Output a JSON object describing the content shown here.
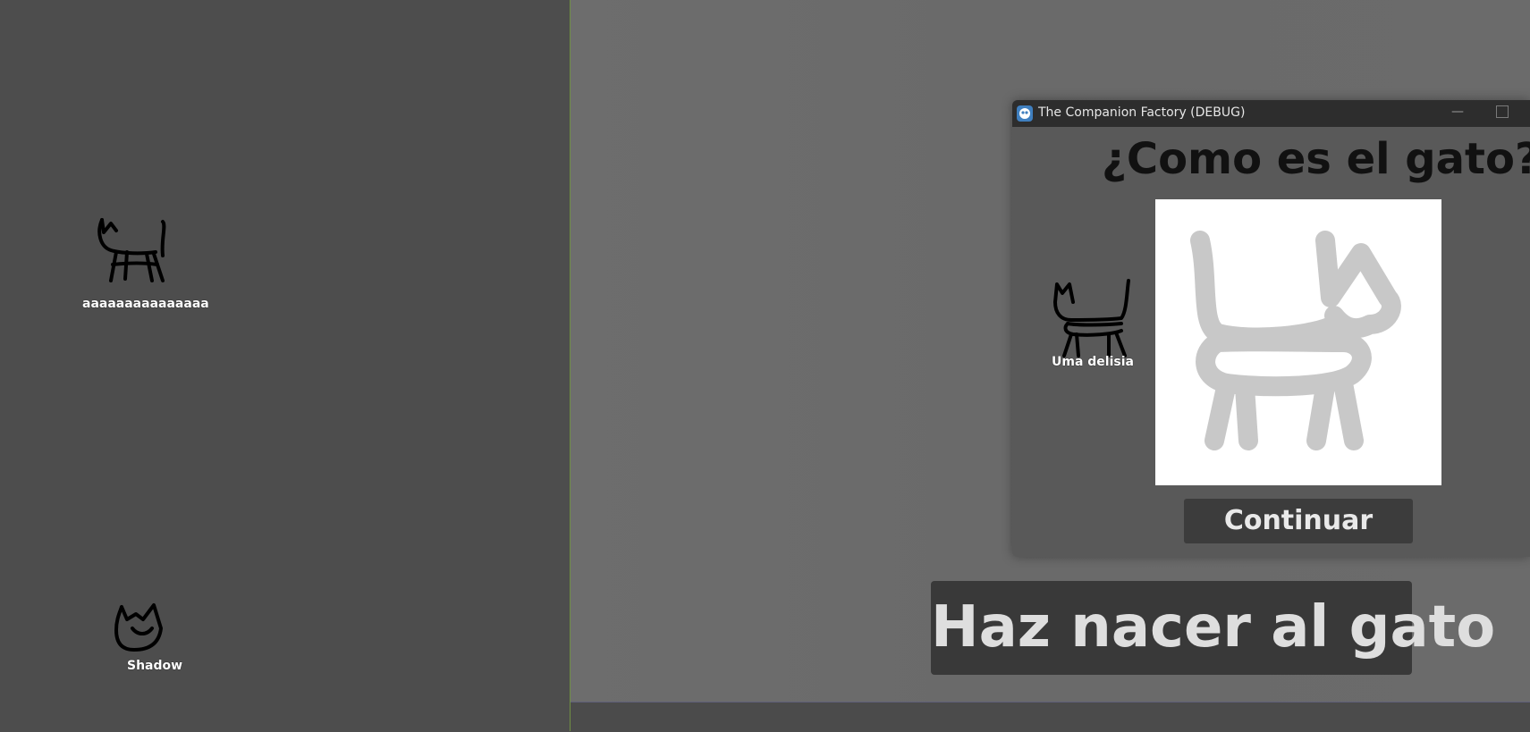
{
  "left_pane": {
    "cats": [
      {
        "name_label": "aaaaaaaaaaaaaaa"
      },
      {
        "name_label": "Shadow"
      }
    ]
  },
  "window": {
    "title": "The Companion Factory (DEBUG)",
    "minimize_symbol": "—",
    "question": "¿Como es el gato?",
    "preview_cat_label": "Uma delisia",
    "continue_label": "Continuar"
  },
  "birth_button_label": "Haz nacer al gato",
  "colors": {
    "left_bg": "#4d4d4d",
    "right_bg": "#6b6b6b",
    "divider": "#6f8f43",
    "button_bg": "#3c3c3c"
  }
}
